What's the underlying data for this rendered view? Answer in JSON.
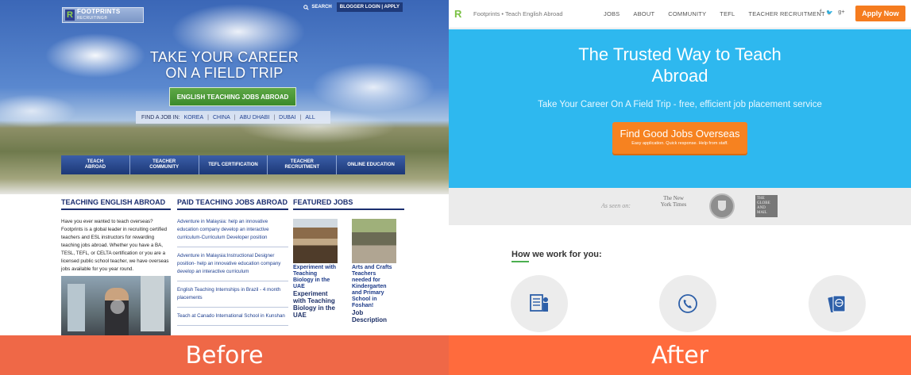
{
  "before": {
    "logo": {
      "mark": "R",
      "name": "FOOTPRINTS",
      "sub": "RECRUITING®"
    },
    "top_links": {
      "search": "SEARCH",
      "login": "BLOGGER LOGIN",
      "apply": "APPLY"
    },
    "headline_line1": "TAKE YOUR CAREER",
    "headline_line2": "ON A FIELD TRIP",
    "cta": "ENGLISH TEACHING JOBS ABROAD",
    "find_job": {
      "label": "FIND A JOB IN:",
      "options": [
        "KOREA",
        "CHINA",
        "ABU DHABI",
        "DUBAI",
        "ALL"
      ]
    },
    "nav": [
      {
        "line1": "TEACH",
        "line2": "ABROAD"
      },
      {
        "line1": "TEACHER",
        "line2": "COMMUNITY"
      },
      {
        "line1": "TEFL CERTIFICATION",
        "line2": ""
      },
      {
        "line1": "TEACHER",
        "line2": "RECRUITMENT"
      },
      {
        "line1": "ONLINE EDUCATION",
        "line2": ""
      }
    ],
    "col1": {
      "title": "TEACHING ENGLISH ABROAD",
      "body": "Have you ever wanted to teach overseas? Footprints is a global leader in recruiting certified teachers and ESL instructors for rewarding teaching jobs abroad.  Whether you have a BA, TESL, TEFL, or CELTA certification or you are a licensed public school teacher, we have overseas jobs available for you year round."
    },
    "col2": {
      "title": "PAID TEACHING JOBS ABROAD",
      "items": [
        "Adventure in Malaysia: help an innovative education company develop an interactive curriculum-Curriculum Developer position",
        "Adventure in Malaysia:Instructional Designer position- help an innovative education company develop an interactive curriculum",
        "English Teaching Internships in Brazil - 4 month placements",
        "Teach at Canado International School in Kunshan"
      ]
    },
    "col3": {
      "title": "FEATURED JOBS",
      "feat1": {
        "title": "Experiment with Teaching Biology in the UAE",
        "title2": "Experiment with Teaching Biology in the UAE"
      },
      "feat2": {
        "title": "Arts and Crafts Teachers needed for Kindergarten and Primary School in Foshan!",
        "title2": "Job Description"
      }
    },
    "label": "Before"
  },
  "after": {
    "logo_mark": "R",
    "brand": "Footprints • Teach English Abroad",
    "nav": [
      "JOBS",
      "ABOUT",
      "COMMUNITY",
      "TEFL",
      "TEACHER RECRUITMENT"
    ],
    "social": [
      "f",
      "𝕥",
      "g+"
    ],
    "apply": "Apply Now",
    "headline_line1": "The Trusted Way to Teach",
    "headline_line2": "Abroad",
    "subtitle": "Take Your Career On A Field Trip - free, efficient job placement service",
    "cta": "Find Good Jobs Overseas",
    "cta_sub": "Easy application. Quick response. Help from staff.",
    "press": {
      "label": "As seen on:",
      "nyt": "The New York Times",
      "globe": "THE GLOBE AND MAIL"
    },
    "how_title": "How we work for you:",
    "icons": [
      "resume-icon",
      "phone-support-icon",
      "passport-icon"
    ],
    "label": "After"
  },
  "colors": {
    "before_label": "#ef6847",
    "after_label": "#ff6b3d",
    "hero_blue": "#2eb8ef",
    "cta_orange": "#f68220",
    "nav_blue": "#1c3877"
  }
}
